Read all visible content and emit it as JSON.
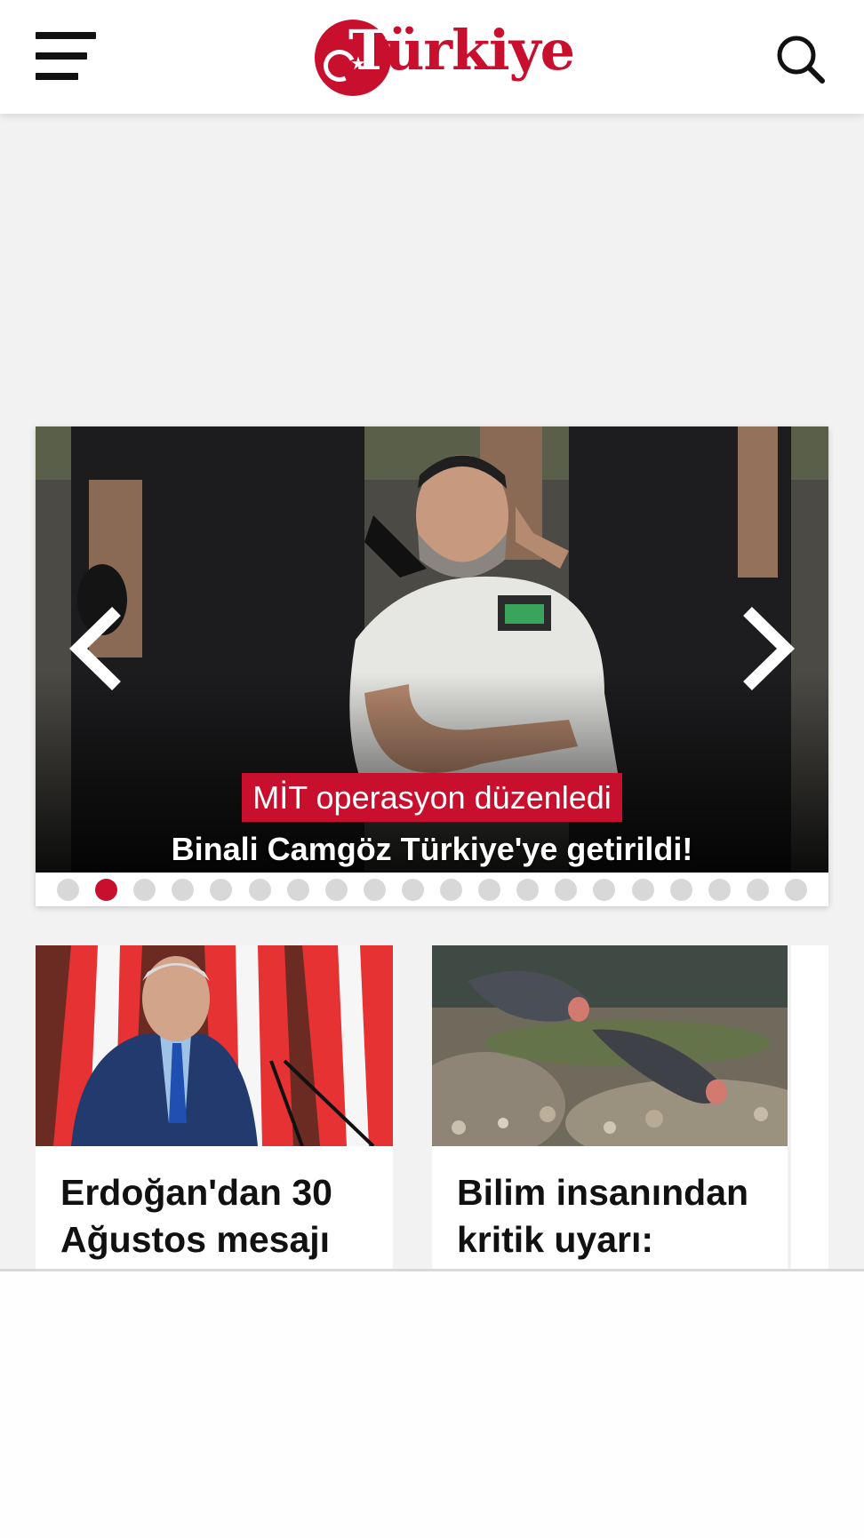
{
  "header": {
    "logo_text": "Türkiye",
    "menu_icon": "hamburger-menu-icon",
    "search_icon": "search-icon"
  },
  "slider": {
    "kicker": "MİT operasyon düzenledi",
    "headline": "Binali Camgöz Türkiye'ye getirildi!",
    "active_index": 1,
    "dot_count": 20,
    "accent": "#c8102e"
  },
  "cards": [
    {
      "title": "Erdoğan'dan 30 Ağustos mesajı"
    },
    {
      "title": "Bilim insanından kritik uyarı:"
    }
  ],
  "colors": {
    "brand_red": "#c8102e",
    "page_bg": "#f2f2f2",
    "dot_inactive": "#d8d8d8"
  }
}
